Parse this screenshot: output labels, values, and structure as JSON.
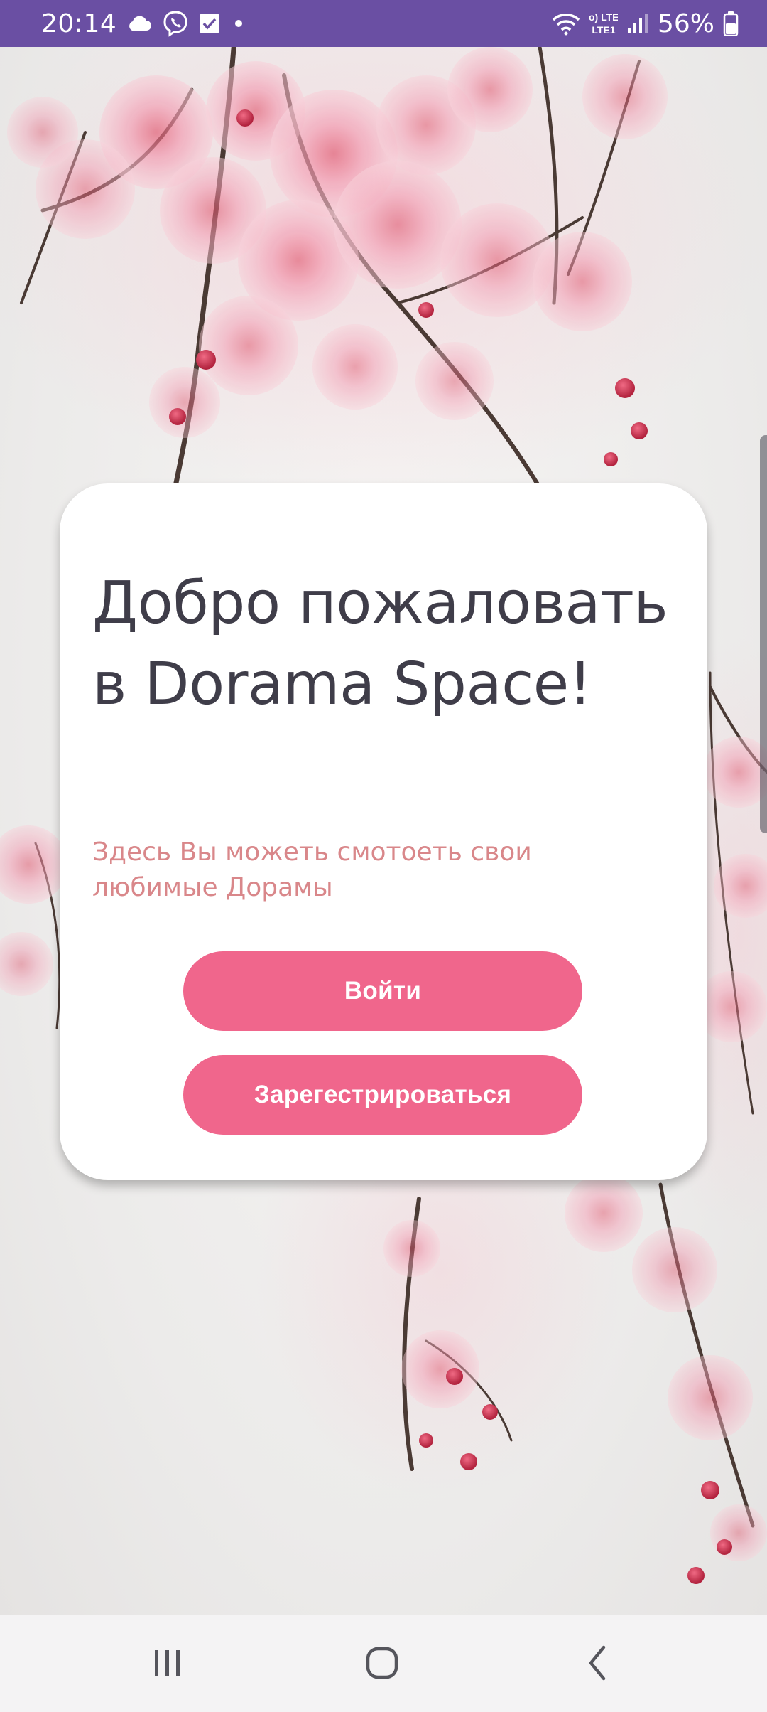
{
  "status_bar": {
    "time": "20:14",
    "network_label": "Vo) LTE1",
    "battery_percent": "56%",
    "battery_level": 0.56,
    "icons": [
      "cloud-icon",
      "viber-icon",
      "checkbox-icon",
      "notification-dot-icon",
      "wifi-icon",
      "volte-lte-icon",
      "signal-icon",
      "battery-icon"
    ]
  },
  "card": {
    "title": "Добро пожаловать в Dorama Space!",
    "subtitle": "Здесь Вы можеть смотоеть свои любимые Дорамы",
    "login_label": "Войти",
    "register_label": "Зарегестрироваться"
  },
  "navigation": {
    "icons": [
      "recents-icon",
      "home-icon",
      "back-icon"
    ]
  },
  "colors": {
    "status_bar": "#6a4fa3",
    "title": "#3f3d49",
    "subtitle": "#d9878a",
    "button": "#f0668c",
    "button_text": "#ffffff",
    "nav_bar": "#f4f3f4"
  }
}
